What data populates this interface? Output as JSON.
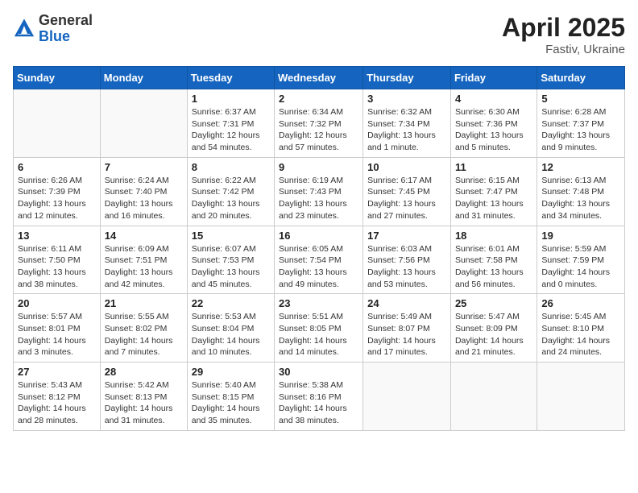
{
  "header": {
    "logo_general": "General",
    "logo_blue": "Blue",
    "month_title": "April 2025",
    "location": "Fastiv, Ukraine"
  },
  "weekdays": [
    "Sunday",
    "Monday",
    "Tuesday",
    "Wednesday",
    "Thursday",
    "Friday",
    "Saturday"
  ],
  "weeks": [
    [
      {
        "day": "",
        "info": ""
      },
      {
        "day": "",
        "info": ""
      },
      {
        "day": "1",
        "info": "Sunrise: 6:37 AM\nSunset: 7:31 PM\nDaylight: 12 hours\nand 54 minutes."
      },
      {
        "day": "2",
        "info": "Sunrise: 6:34 AM\nSunset: 7:32 PM\nDaylight: 12 hours\nand 57 minutes."
      },
      {
        "day": "3",
        "info": "Sunrise: 6:32 AM\nSunset: 7:34 PM\nDaylight: 13 hours\nand 1 minute."
      },
      {
        "day": "4",
        "info": "Sunrise: 6:30 AM\nSunset: 7:36 PM\nDaylight: 13 hours\nand 5 minutes."
      },
      {
        "day": "5",
        "info": "Sunrise: 6:28 AM\nSunset: 7:37 PM\nDaylight: 13 hours\nand 9 minutes."
      }
    ],
    [
      {
        "day": "6",
        "info": "Sunrise: 6:26 AM\nSunset: 7:39 PM\nDaylight: 13 hours\nand 12 minutes."
      },
      {
        "day": "7",
        "info": "Sunrise: 6:24 AM\nSunset: 7:40 PM\nDaylight: 13 hours\nand 16 minutes."
      },
      {
        "day": "8",
        "info": "Sunrise: 6:22 AM\nSunset: 7:42 PM\nDaylight: 13 hours\nand 20 minutes."
      },
      {
        "day": "9",
        "info": "Sunrise: 6:19 AM\nSunset: 7:43 PM\nDaylight: 13 hours\nand 23 minutes."
      },
      {
        "day": "10",
        "info": "Sunrise: 6:17 AM\nSunset: 7:45 PM\nDaylight: 13 hours\nand 27 minutes."
      },
      {
        "day": "11",
        "info": "Sunrise: 6:15 AM\nSunset: 7:47 PM\nDaylight: 13 hours\nand 31 minutes."
      },
      {
        "day": "12",
        "info": "Sunrise: 6:13 AM\nSunset: 7:48 PM\nDaylight: 13 hours\nand 34 minutes."
      }
    ],
    [
      {
        "day": "13",
        "info": "Sunrise: 6:11 AM\nSunset: 7:50 PM\nDaylight: 13 hours\nand 38 minutes."
      },
      {
        "day": "14",
        "info": "Sunrise: 6:09 AM\nSunset: 7:51 PM\nDaylight: 13 hours\nand 42 minutes."
      },
      {
        "day": "15",
        "info": "Sunrise: 6:07 AM\nSunset: 7:53 PM\nDaylight: 13 hours\nand 45 minutes."
      },
      {
        "day": "16",
        "info": "Sunrise: 6:05 AM\nSunset: 7:54 PM\nDaylight: 13 hours\nand 49 minutes."
      },
      {
        "day": "17",
        "info": "Sunrise: 6:03 AM\nSunset: 7:56 PM\nDaylight: 13 hours\nand 53 minutes."
      },
      {
        "day": "18",
        "info": "Sunrise: 6:01 AM\nSunset: 7:58 PM\nDaylight: 13 hours\nand 56 minutes."
      },
      {
        "day": "19",
        "info": "Sunrise: 5:59 AM\nSunset: 7:59 PM\nDaylight: 14 hours\nand 0 minutes."
      }
    ],
    [
      {
        "day": "20",
        "info": "Sunrise: 5:57 AM\nSunset: 8:01 PM\nDaylight: 14 hours\nand 3 minutes."
      },
      {
        "day": "21",
        "info": "Sunrise: 5:55 AM\nSunset: 8:02 PM\nDaylight: 14 hours\nand 7 minutes."
      },
      {
        "day": "22",
        "info": "Sunrise: 5:53 AM\nSunset: 8:04 PM\nDaylight: 14 hours\nand 10 minutes."
      },
      {
        "day": "23",
        "info": "Sunrise: 5:51 AM\nSunset: 8:05 PM\nDaylight: 14 hours\nand 14 minutes."
      },
      {
        "day": "24",
        "info": "Sunrise: 5:49 AM\nSunset: 8:07 PM\nDaylight: 14 hours\nand 17 minutes."
      },
      {
        "day": "25",
        "info": "Sunrise: 5:47 AM\nSunset: 8:09 PM\nDaylight: 14 hours\nand 21 minutes."
      },
      {
        "day": "26",
        "info": "Sunrise: 5:45 AM\nSunset: 8:10 PM\nDaylight: 14 hours\nand 24 minutes."
      }
    ],
    [
      {
        "day": "27",
        "info": "Sunrise: 5:43 AM\nSunset: 8:12 PM\nDaylight: 14 hours\nand 28 minutes."
      },
      {
        "day": "28",
        "info": "Sunrise: 5:42 AM\nSunset: 8:13 PM\nDaylight: 14 hours\nand 31 minutes."
      },
      {
        "day": "29",
        "info": "Sunrise: 5:40 AM\nSunset: 8:15 PM\nDaylight: 14 hours\nand 35 minutes."
      },
      {
        "day": "30",
        "info": "Sunrise: 5:38 AM\nSunset: 8:16 PM\nDaylight: 14 hours\nand 38 minutes."
      },
      {
        "day": "",
        "info": ""
      },
      {
        "day": "",
        "info": ""
      },
      {
        "day": "",
        "info": ""
      }
    ]
  ]
}
